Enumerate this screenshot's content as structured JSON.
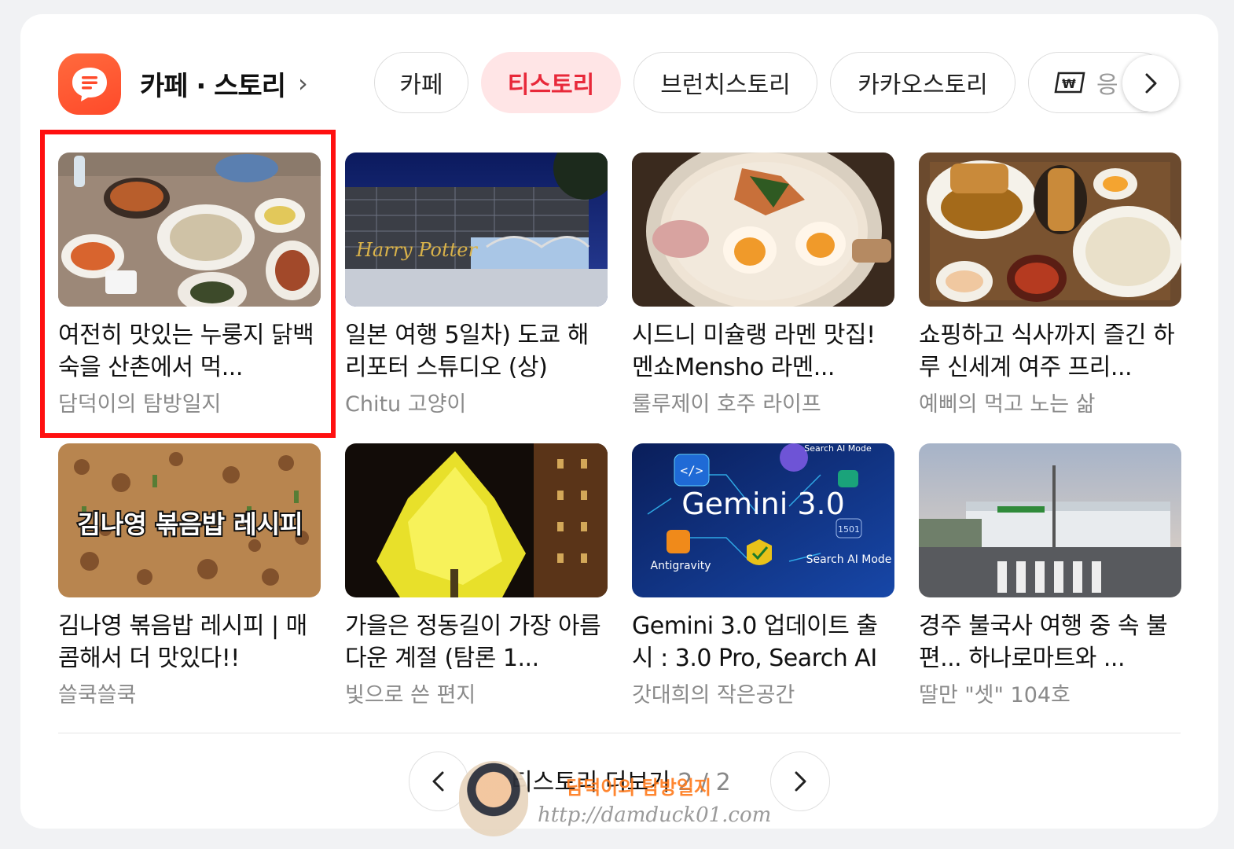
{
  "header": {
    "title": "카페 · 스토리",
    "title_chevron": "›",
    "brand_color": "#ff5a2f",
    "tabs": [
      {
        "label": "카페",
        "active": false
      },
      {
        "label": "티스토리",
        "active": true
      },
      {
        "label": "브런치스토리",
        "active": false
      },
      {
        "label": "카카오스토리",
        "active": false
      },
      {
        "label": "응",
        "active": false,
        "icon": "won-coupon-icon"
      }
    ],
    "active_color": "#e8293a"
  },
  "posts": [
    {
      "title": "여전히 맛있는 누룽지 닭백숙을 산촌에서 먹...",
      "author": "담덕이의 탐방일지",
      "thumb": "food-korean-chicken",
      "highlighted": true
    },
    {
      "title": "일본 여행 5일차) 도쿄 해리포터 스튜디오 (상)",
      "author": "Chitu 고양이",
      "thumb": "harry-potter-studio"
    },
    {
      "title": "시드니 미슐랭 라멘 맛집! 멘쇼Mensho 라멘...",
      "author": "룰루제이 호주 라이프",
      "thumb": "ramen-bowl"
    },
    {
      "title": "쇼핑하고 식사까지 즐긴 하루 신세계 여주 프리...",
      "author": "예삐의 먹고 노는 삶",
      "thumb": "tonkatsu-set"
    },
    {
      "title": "김나영 볶음밥 레시피 | 매콤해서 더 맛있다!!",
      "author": "쓸쿡쓸쿡",
      "thumb": "fried-rice",
      "thumb_text": "김나영 볶음밥 레시피"
    },
    {
      "title": "가을은 정동길이 가장 아름다운 계절 (탐론 1...",
      "author": "빛으로 쓴 편지",
      "thumb": "ginkgo-night"
    },
    {
      "title": "Gemini 3.0 업데이트 출시 : 3.0 Pro, Search AI ...",
      "author": "갓대희의 작은공간",
      "thumb": "gemini-graphic",
      "thumb_text": "Gemini 3.0",
      "thumb_labels": [
        "Search AI Mode",
        "Antigravity",
        "Search AI Mode",
        "1501"
      ]
    },
    {
      "title": "경주 불국사 여행 중 속 불편... 하나로마트와 ...",
      "author": "딸만 \"셋\" 104호",
      "thumb": "street-mart"
    }
  ],
  "footer": {
    "more_label": "티스토리 더보기",
    "page": "2 / 2"
  },
  "watermark": {
    "name": "담덕이의 탐방일지",
    "url": "http://damduck01.com"
  }
}
